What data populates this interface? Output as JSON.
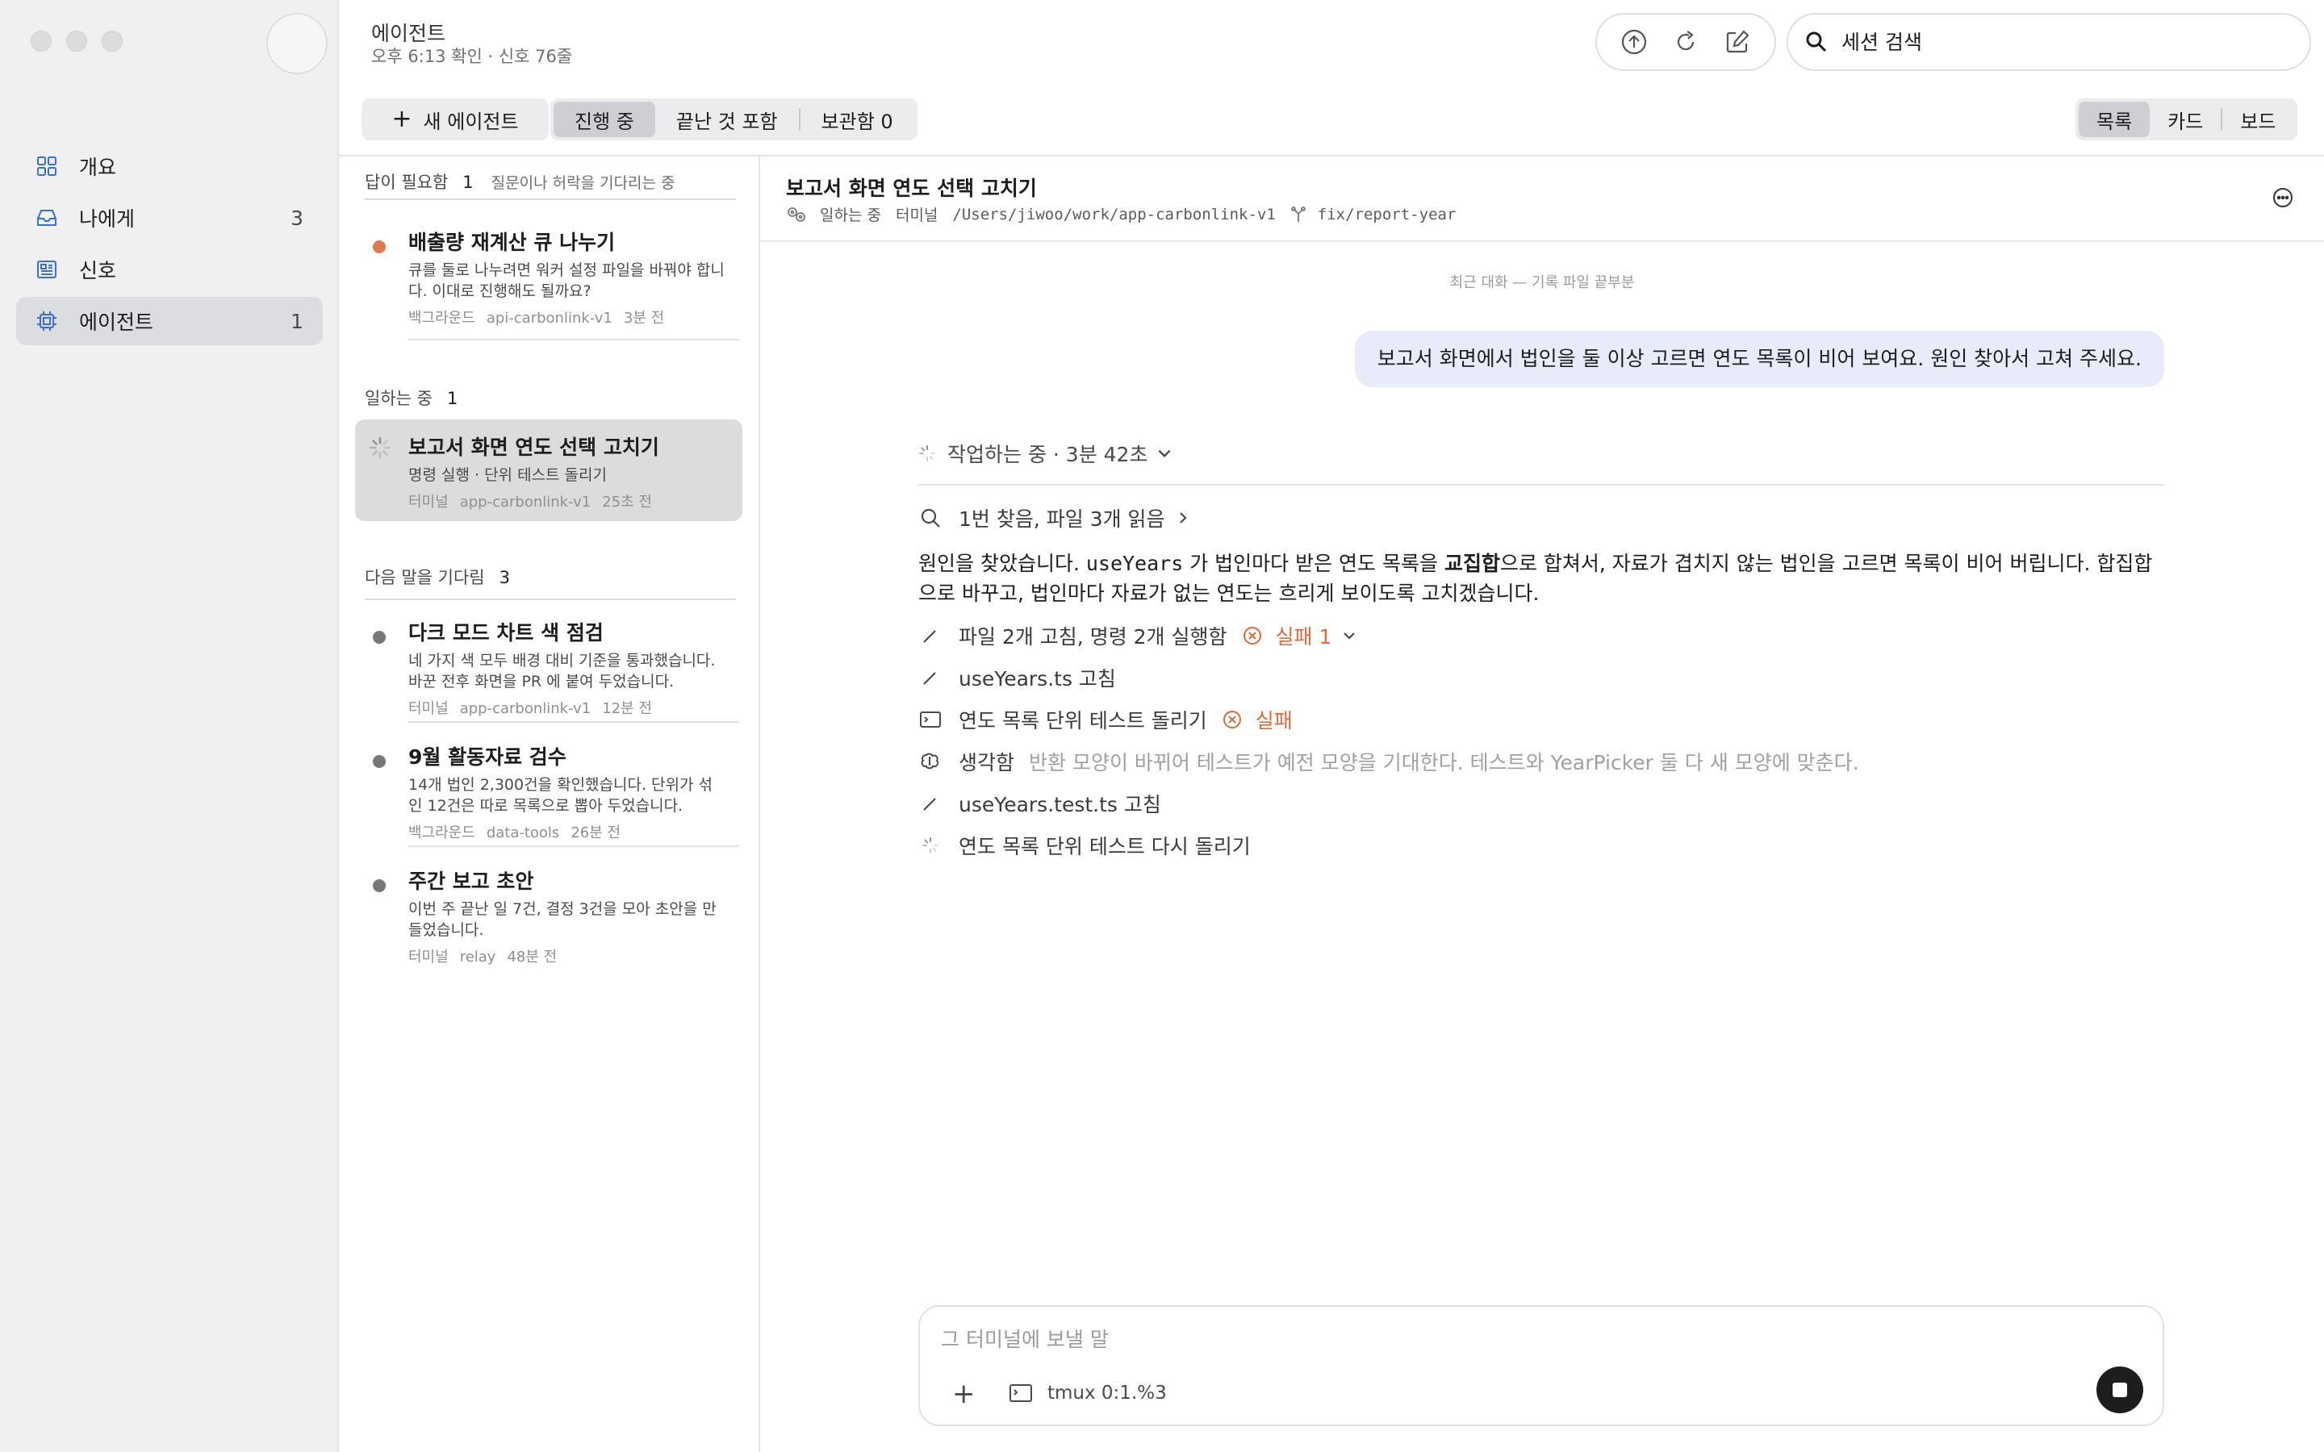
{
  "sidebar": {
    "items": [
      {
        "label": "개요",
        "count": "",
        "icon": "grid-icon"
      },
      {
        "label": "나에게",
        "count": "3",
        "icon": "inbox-icon"
      },
      {
        "label": "신호",
        "count": "",
        "icon": "newspaper-icon"
      },
      {
        "label": "에이전트",
        "count": "1",
        "icon": "chip-icon",
        "active": true
      }
    ]
  },
  "header": {
    "title": "에이전트",
    "subtitle": "오후 6:13 확인 · 신호 76줄",
    "search_placeholder": "세션 검색",
    "tools": [
      "upload-icon",
      "refresh-icon",
      "compose-icon"
    ]
  },
  "toolbar": {
    "new_agent": "새 에이전트",
    "filters": [
      "진행 중",
      "끝난 것 포함",
      "보관함 0"
    ],
    "active_filter": "진행 중",
    "views": [
      "목록",
      "카드",
      "보드"
    ],
    "active_view": "목록"
  },
  "sections": {
    "needs_answer": {
      "title": "답이 필요함",
      "count": "1",
      "hint": "질문이나 허락을 기다리는 중",
      "items": [
        {
          "title": "배출량 재계산 큐 나누기",
          "desc": "큐를 둘로 나누려면 워커 설정 파일을 바꿔야 합니다. 이대로 진행해도 될까요?",
          "kind": "백그라운드",
          "repo": "api-carbonlink-v1",
          "time": "3분 전"
        }
      ]
    },
    "working": {
      "title": "일하는 중",
      "count": "1",
      "items": [
        {
          "title": "보고서 화면 연도 선택 고치기",
          "desc": "명령 실행 · 단위 테스트 돌리기",
          "kind": "터미널",
          "repo": "app-carbonlink-v1",
          "time": "25초 전"
        }
      ]
    },
    "waiting": {
      "title": "다음 말을 기다림",
      "count": "3",
      "items": [
        {
          "title": "다크 모드 차트 색 점검",
          "desc": "네 가지 색 모두 배경 대비 기준을 통과했습니다. 바꾼 전후 화면을 PR 에 붙여 두었습니다.",
          "kind": "터미널",
          "repo": "app-carbonlink-v1",
          "time": "12분 전"
        },
        {
          "title": "9월 활동자료 검수",
          "desc": "14개 법인 2,300건을 확인했습니다. 단위가 섞인 12건은 따로 목록으로 뽑아 두었습니다.",
          "kind": "백그라운드",
          "repo": "data-tools",
          "time": "26분 전"
        },
        {
          "title": "주간 보고 초안",
          "desc": "이번 주 끝난 일 7건, 결정 3건을 모아 초안을 만들었습니다.",
          "kind": "터미널",
          "repo": "relay",
          "time": "48분 전"
        }
      ]
    }
  },
  "conversation": {
    "title": "보고서 화면 연도 선택 고치기",
    "status": "일하는 중",
    "kind": "터미널",
    "path": "/Users/jiwoo/work/app-carbonlink-v1",
    "branch": "fix/report-year",
    "recent_label": "최근 대화 — 기록 파일 끝부분",
    "user_message": "보고서 화면에서 법인을 둘 이상 고르면 연도 목록이 비어 보여요. 원인 찾아서 고쳐 주세요.",
    "working_label": "작업하는 중 · 3분 42초",
    "search_summary": "1번 찾음, 파일 3개 읽음",
    "explanation": {
      "p1": "원인을 찾았습니다. ",
      "code": "useYears",
      "p2": " 가 법인마다 받은 연도 목록을 ",
      "bold": "교집합",
      "p3": "으로 합쳐서, 자료가 겹치지 않는 법인을 고르면 목록이 비어 버립니다. 합집합으로 바꾸고, 법인마다 자료가 없는 연도는 흐리게 보이도록 고치겠습니다."
    },
    "steps": {
      "summary": "파일 2개 고침, 명령 2개 실행함",
      "summary_fail": "실패 1",
      "edit1": "useYears.ts 고침",
      "test1": "연도 목록 단위 테스트 돌리기",
      "test1_status": "실패",
      "think_label": "생각함",
      "think_text": "반환 모양이 바뀌어 테스트가 예전 모양을 기대한다. 테스트와 YearPicker 둘 다 새 모양에 맞춘다.",
      "edit2": "useYears.test.ts 고침",
      "test2": "연도 목록 단위 테스트 다시 돌리기"
    },
    "composer_placeholder": "그 터미널에 보낼 말",
    "terminal_target": "tmux 0:1.%3"
  },
  "colors": {
    "accent_blue": "#3a6fd8",
    "fail_orange": "#e06a3c",
    "user_bubble": "#e8ecfa"
  }
}
